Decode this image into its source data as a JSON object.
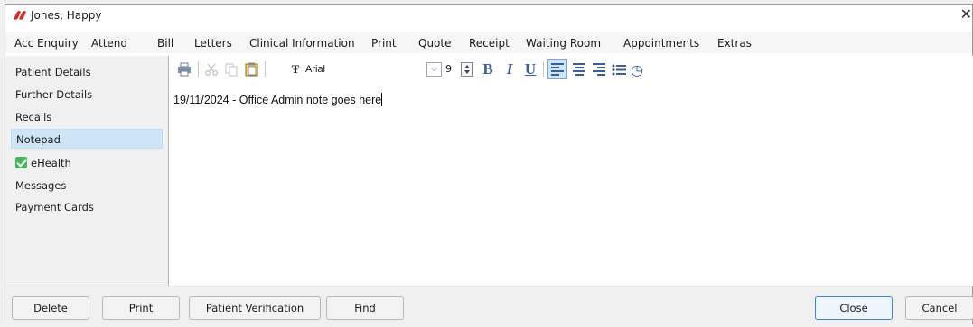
{
  "window": {
    "title": "Jones, Happy",
    "close_glyph": "✕"
  },
  "menu": [
    "Acc Enquiry",
    "Attend",
    "Bill",
    "Letters",
    "Clinical Information",
    "Print",
    "Quote",
    "Receipt",
    "Waiting Room",
    "Appointments",
    "Extras"
  ],
  "sidebar": {
    "items": [
      {
        "label": "Patient Details"
      },
      {
        "label": "Further Details"
      },
      {
        "label": "Recalls"
      },
      {
        "label": "Notepad",
        "selected": true
      },
      {
        "label": "eHealth",
        "icon": "green-check-icon"
      },
      {
        "label": "Messages"
      },
      {
        "label": "Payment Cards"
      }
    ]
  },
  "toolbar": {
    "font_glyph": "Ŧ",
    "font_name": "Arial",
    "font_size": "9",
    "bold": "B",
    "italic": "I",
    "underline": "U",
    "clock_glyph": "◷",
    "font_dropdown_glyph": "⌵"
  },
  "editor": {
    "text": "19/11/2024 - Office Admin note goes here"
  },
  "buttons": {
    "delete": "Delete",
    "print": "Print",
    "patient_verification": "Patient Verification",
    "find": "Find",
    "close_pre": "Cl",
    "close_accel": "o",
    "close_post": "se",
    "cancel_accel": "C",
    "cancel_post": "ancel"
  },
  "colors": {
    "accent": "#3b82d8",
    "selection": "#cde5f7",
    "toolbar_icon": "#3d5f8f",
    "check": "#47b85a",
    "logo": "#d0312d"
  }
}
